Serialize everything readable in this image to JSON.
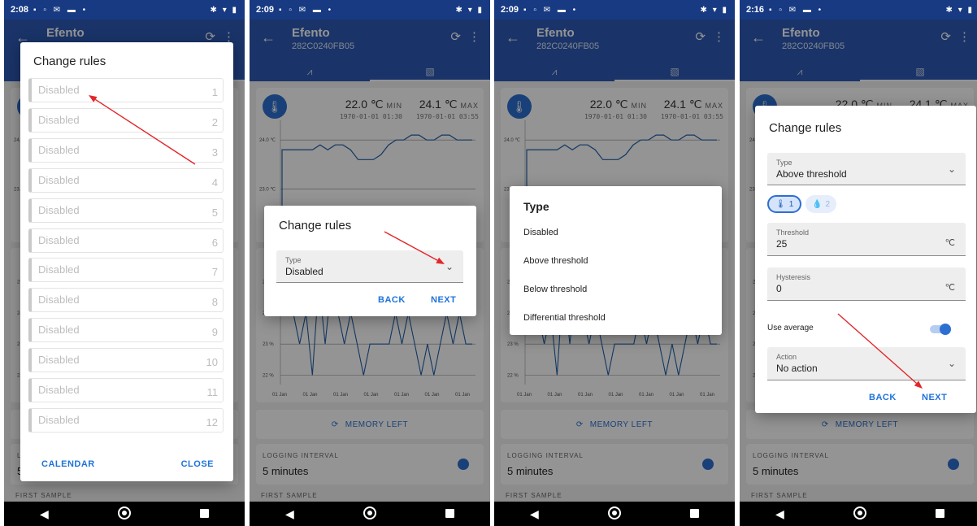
{
  "colors": {
    "app_bar": "#2d5bb5",
    "status_bar": "#173a82",
    "accent": "#1e73d9",
    "sensor_badge": "#2d6fd1",
    "annotation_arrow": "#e3262a",
    "chart_line": "#1f5fa8"
  },
  "icons": {
    "back": "arrow-left-icon",
    "refresh": "refresh-icon",
    "menu": "kebab-menu-icon",
    "thermometer": "thermometer-icon",
    "humidity": "water-drop-icon",
    "timer": "stopwatch-icon",
    "chevron": "chevron-down-icon"
  },
  "app": {
    "title": "Efento",
    "device_id": "282C0240FB05"
  },
  "stats": {
    "min_value": "22.0 ℃",
    "min_label": "MIN",
    "min_time": "1970-01-01 01:30",
    "max_value": "24.1 ℃",
    "max_label": "MAX",
    "max_time": "1970-01-01 03:55"
  },
  "chart_data": [
    {
      "type": "line",
      "ylabel": "",
      "yticks": [
        "24.0 ℃",
        "23.0 ℃"
      ],
      "x": [
        0,
        1,
        2,
        3,
        4,
        5,
        6,
        7,
        8,
        9,
        10,
        11,
        12,
        13,
        14,
        15,
        16,
        17,
        18,
        19,
        20,
        21,
        22,
        23,
        24,
        25
      ],
      "values": [
        23.8,
        23.8,
        23.8,
        23.8,
        23.8,
        23.9,
        23.8,
        23.9,
        23.9,
        23.8,
        23.6,
        23.6,
        23.6,
        23.7,
        23.9,
        24.0,
        24.0,
        24.1,
        24.1,
        24.0,
        24.0,
        24.1,
        24.1,
        24.0,
        24.0,
        24.0
      ]
    },
    {
      "type": "line",
      "yticks": [
        "25 %",
        "24 %",
        "23 %",
        "22 %"
      ],
      "ylim": [
        22,
        25
      ],
      "x_tick_labels": [
        "01 Jan",
        "01 Jan",
        "01 Jan",
        "01 Jan",
        "01 Jan",
        "01 Jan",
        "01 Jan"
      ],
      "values": [
        24,
        24,
        24,
        23,
        24,
        22,
        25,
        23,
        25,
        24,
        23,
        24,
        23,
        22,
        23,
        23,
        23,
        23,
        24,
        23,
        24,
        23,
        22,
        23,
        22,
        23,
        24,
        23,
        24,
        23,
        23
      ]
    }
  ],
  "memory": {
    "label": "MEMORY LEFT"
  },
  "logging": {
    "label": "LOGGING INTERVAL",
    "value": "5 minutes"
  },
  "first_sample": {
    "label": "FIRST SAMPLE"
  },
  "statusbar": {
    "screens": [
      {
        "time": "2:08"
      },
      {
        "time": "2:09"
      },
      {
        "time": "2:09"
      },
      {
        "time": "2:16"
      }
    ]
  },
  "screen1": {
    "dialog_title": "Change rules",
    "rules": [
      {
        "label": "Disabled",
        "number": "1"
      },
      {
        "label": "Disabled",
        "number": "2"
      },
      {
        "label": "Disabled",
        "number": "3"
      },
      {
        "label": "Disabled",
        "number": "4"
      },
      {
        "label": "Disabled",
        "number": "5"
      },
      {
        "label": "Disabled",
        "number": "6"
      },
      {
        "label": "Disabled",
        "number": "7"
      },
      {
        "label": "Disabled",
        "number": "8"
      },
      {
        "label": "Disabled",
        "number": "9"
      },
      {
        "label": "Disabled",
        "number": "10"
      },
      {
        "label": "Disabled",
        "number": "11"
      },
      {
        "label": "Disabled",
        "number": "12"
      }
    ],
    "calendar_button": "CALENDAR",
    "close_button": "CLOSE"
  },
  "screen2": {
    "dialog_title": "Change rules",
    "type_label": "Type",
    "type_value": "Disabled",
    "back_button": "BACK",
    "next_button": "NEXT"
  },
  "screen3": {
    "menu_title": "Type",
    "options": [
      "Disabled",
      "Above threshold",
      "Below threshold",
      "Differential threshold"
    ]
  },
  "screen4": {
    "dialog_title": "Change rules",
    "type_label": "Type",
    "type_value": "Above threshold",
    "chip_temperature": "1",
    "chip_humidity": "2",
    "threshold_label": "Threshold",
    "threshold_value": "25",
    "threshold_unit": "℃",
    "hysteresis_label": "Hysteresis",
    "hysteresis_value": "0",
    "hysteresis_unit": "℃",
    "use_average_label": "Use average",
    "use_average_enabled": true,
    "action_label": "Action",
    "action_value": "No action",
    "back_button": "BACK",
    "next_button": "NEXT"
  }
}
